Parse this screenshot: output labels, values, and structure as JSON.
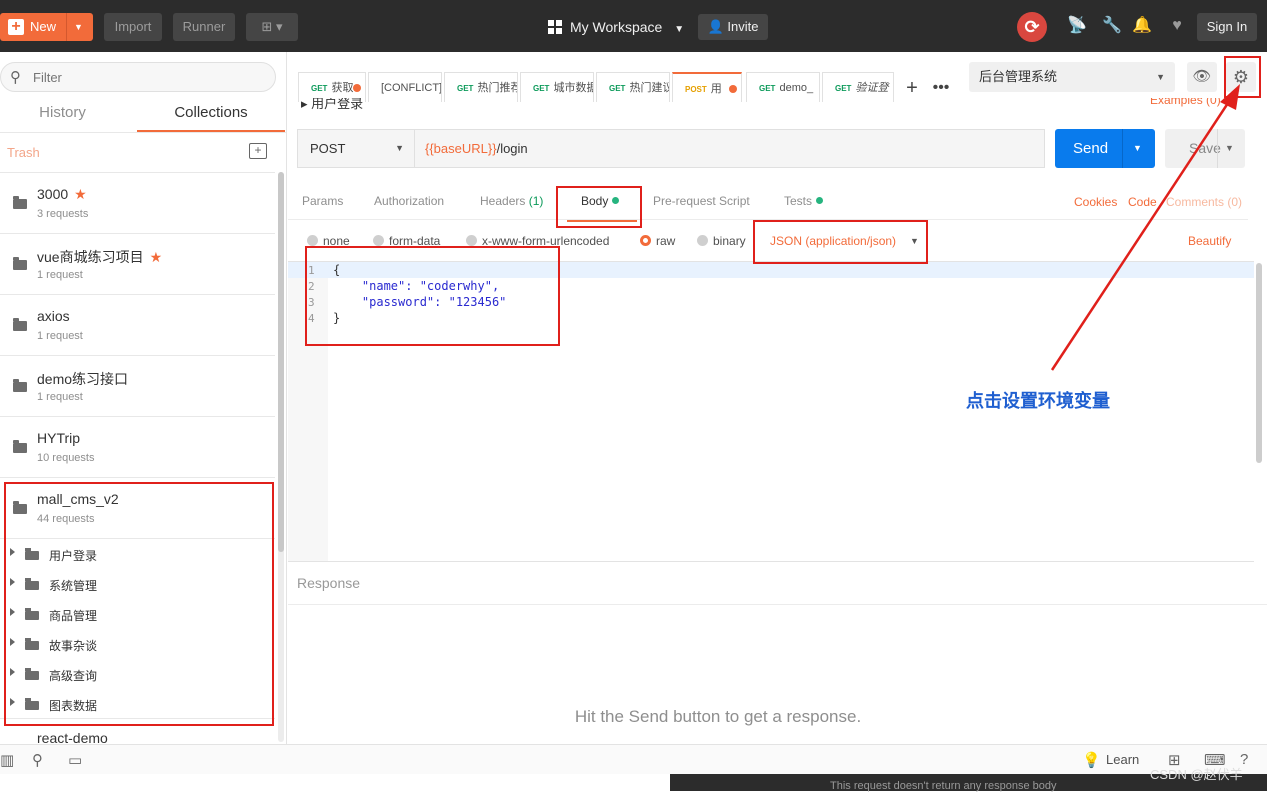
{
  "header": {
    "new_label": "New",
    "import_label": "Import",
    "runner_label": "Runner",
    "workspace_label": "My Workspace",
    "invite_label": "Invite",
    "signin_label": "Sign In"
  },
  "sidebar": {
    "filter_placeholder": "Filter",
    "tabs": [
      "History",
      "Collections"
    ],
    "trash_label": "Trash",
    "collections": [
      {
        "name": "3000",
        "count": "3 requests",
        "starred": true
      },
      {
        "name": "vue商城练习项目",
        "count": "1 request",
        "starred": true
      },
      {
        "name": "axios",
        "count": "1 request",
        "starred": false
      },
      {
        "name": "demo练习接口",
        "count": "1 request",
        "starred": false
      },
      {
        "name": "HYTrip",
        "count": "10 requests",
        "starred": false
      },
      {
        "name": "mall_cms_v2",
        "count": "44 requests",
        "starred": false
      }
    ],
    "folders": [
      "用户登录",
      "系统管理",
      "商品管理",
      "故事杂谈",
      "高级查询",
      "图表数据"
    ],
    "next_collection": "react-demo"
  },
  "request_tabs": [
    {
      "method": "GET",
      "label": "获取",
      "dot": true
    },
    {
      "method": "",
      "label": "[CONFLICT]",
      "dot": false
    },
    {
      "method": "GET",
      "label": "热门推荐",
      "dot": false
    },
    {
      "method": "GET",
      "label": "城市数据",
      "dot": false
    },
    {
      "method": "GET",
      "label": "热门建议",
      "dot": false
    },
    {
      "method": "POST",
      "label": "用",
      "dot": true,
      "active": true
    },
    {
      "method": "GET",
      "label": "demo_",
      "dot": false
    },
    {
      "method": "GET",
      "label": "验证登",
      "dot": false
    }
  ],
  "environment": {
    "selected": "后台管理系统"
  },
  "request": {
    "title": "用户登录",
    "examples": "Examples (0)",
    "method": "POST",
    "url_var": "{{baseURL}}",
    "url_path": "/login",
    "send_label": "Send",
    "save_label": "Save"
  },
  "request_subtabs": {
    "params": "Params",
    "authorization": "Authorization",
    "headers": "Headers",
    "headers_count": "(1)",
    "body": "Body",
    "prerequest": "Pre-request Script",
    "tests": "Tests",
    "cookies": "Cookies",
    "code": "Code",
    "comments": "Comments (0)"
  },
  "body_options": {
    "modes": [
      "none",
      "form-data",
      "x-www-form-urlencoded",
      "raw",
      "binary"
    ],
    "selected_mode": "raw",
    "content_type": "JSON (application/json)",
    "beautify": "Beautify"
  },
  "editor": {
    "line_numbers": [
      "1",
      "2",
      "3",
      "4"
    ],
    "lines": [
      "{",
      "    \"name\": \"coderwhy\",",
      "    \"password\": \"123456\"",
      "}"
    ]
  },
  "response": {
    "label": "Response",
    "empty_message": "Hit the Send button to get a response.",
    "below_message": "This request doesn't return any response body"
  },
  "footer": {
    "learn_label": "Learn",
    "watermark": "CSDN @赵伏羊"
  },
  "annotation": {
    "text": "点击设置环境变量",
    "color": "#1f5fd0",
    "box_color": "#e0201b"
  },
  "colors": {
    "accent": "#f26b3a",
    "send_blue": "#097bed",
    "header_bg": "#2c2c2c"
  }
}
